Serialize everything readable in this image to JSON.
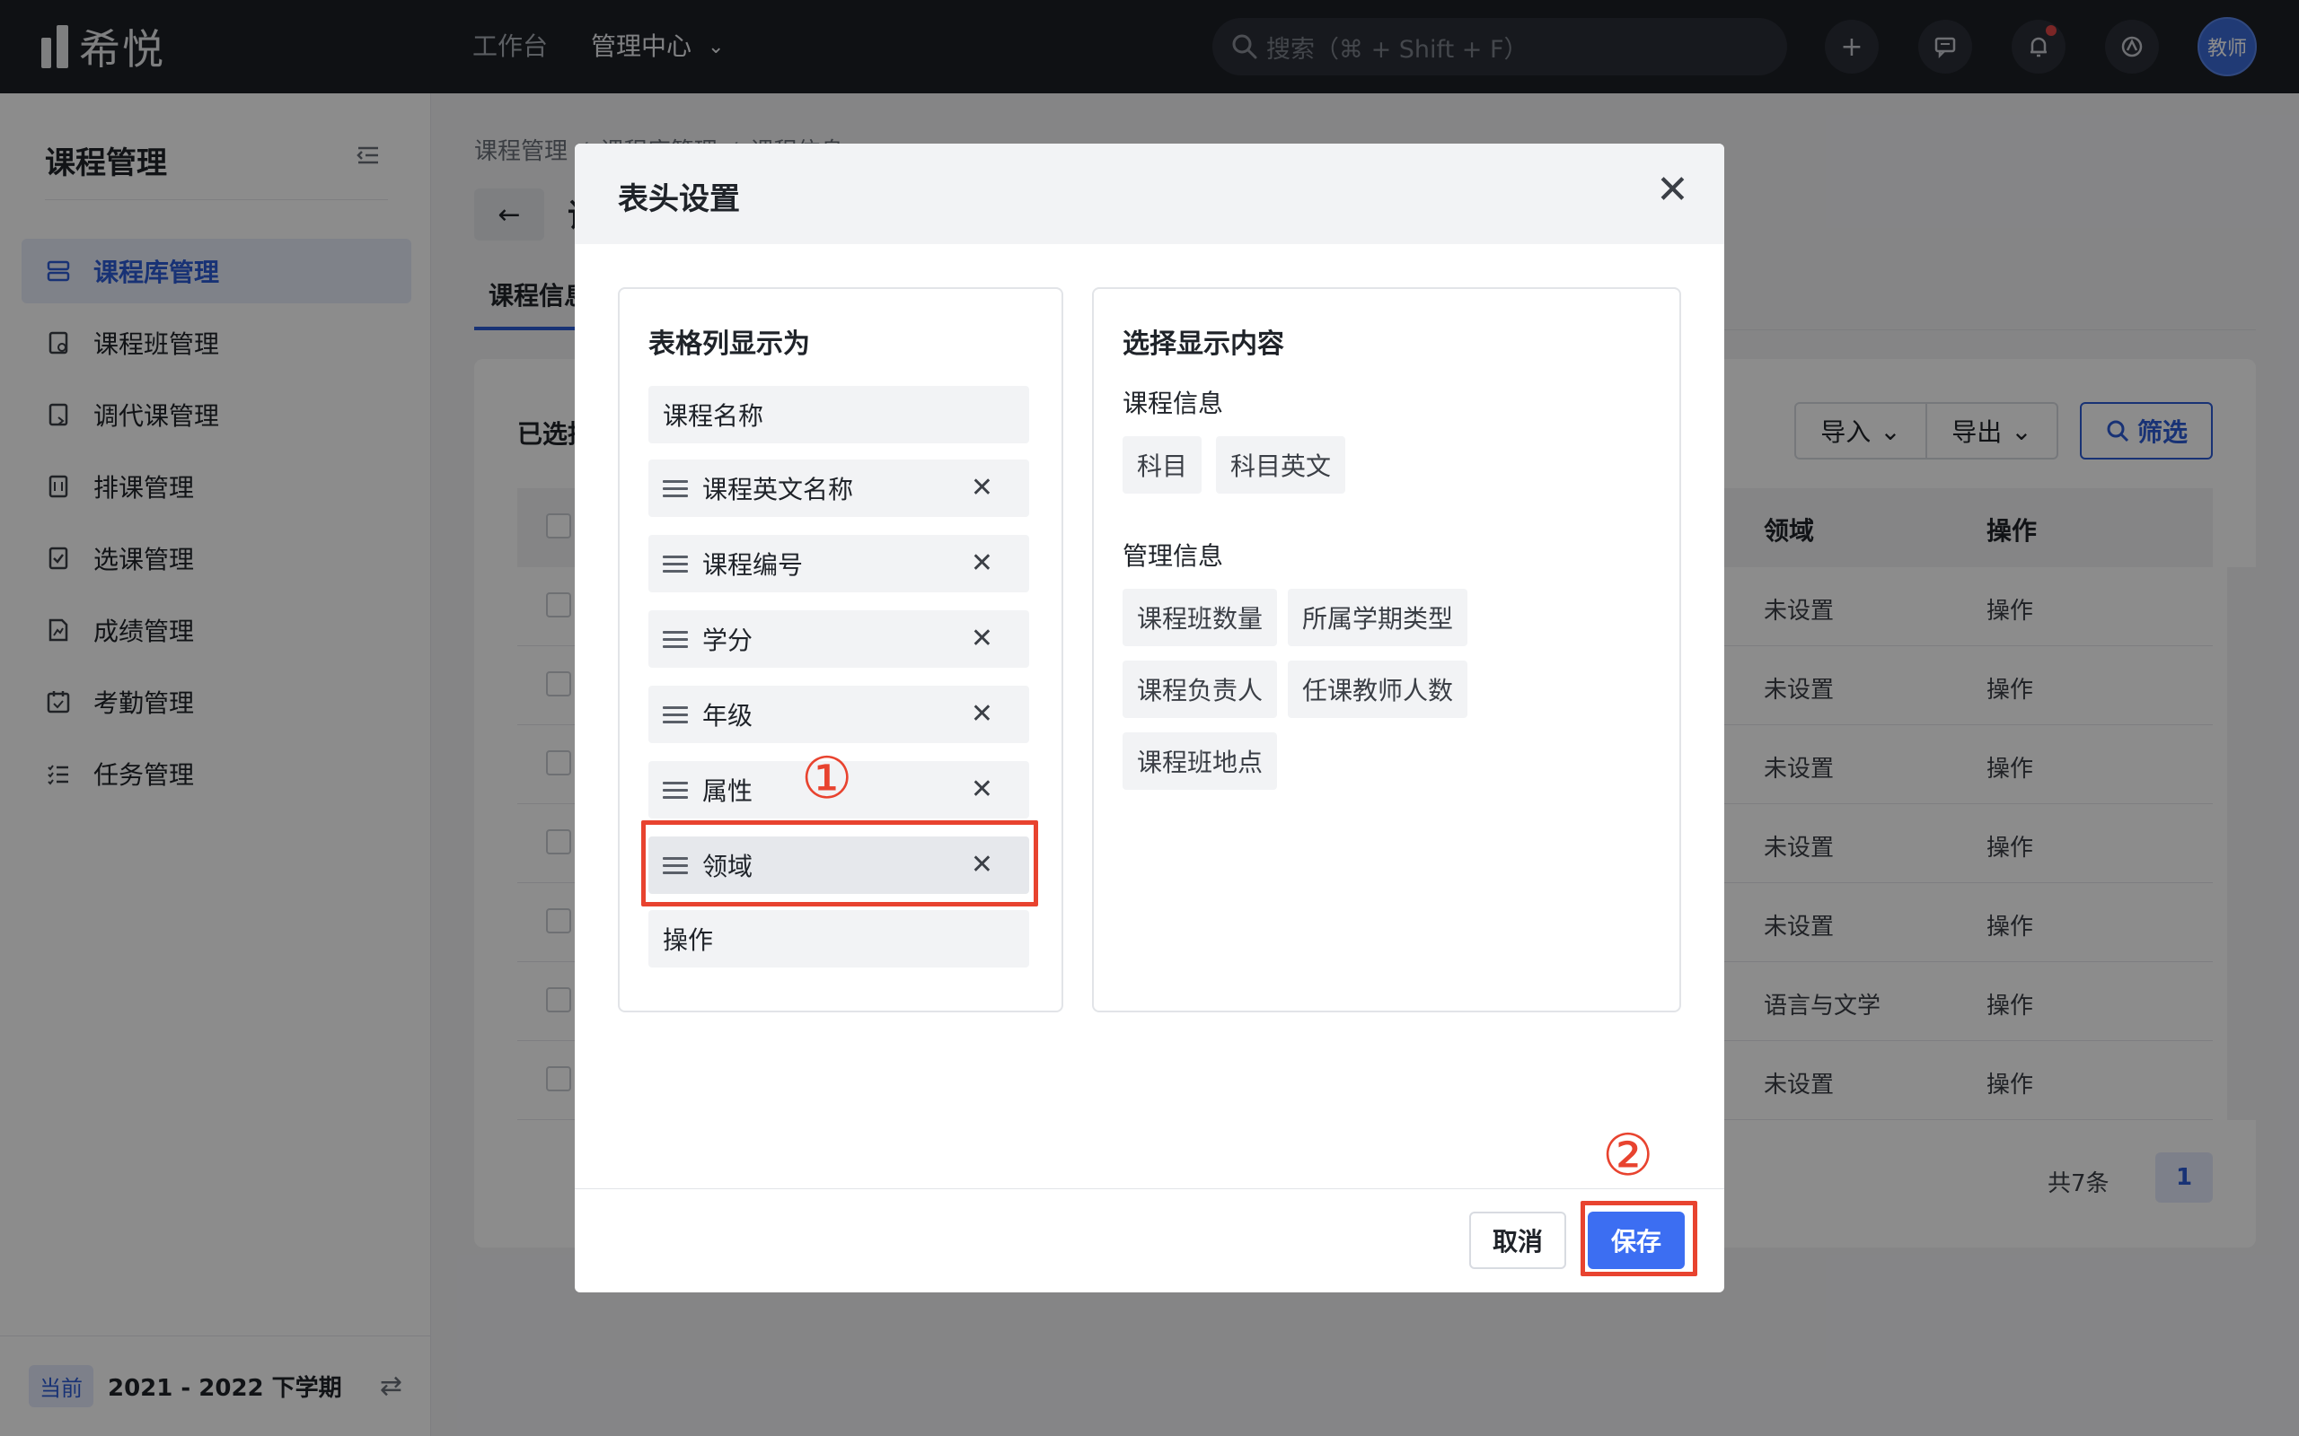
{
  "topbar": {
    "logo_text": "希悦",
    "nav": [
      {
        "label": "工作台"
      },
      {
        "label": "管理中心"
      }
    ],
    "search_placeholder": "搜索（⌘ + Shift + F）",
    "avatar_label": "教师",
    "colors": {
      "background": "#1c1f26",
      "notification_dot": "#e04545"
    }
  },
  "sidebar": {
    "title": "课程管理",
    "items": [
      {
        "label": "课程库管理",
        "icon": "database-icon",
        "active": true
      },
      {
        "label": "课程班管理",
        "icon": "class-icon"
      },
      {
        "label": "调代课管理",
        "icon": "substitute-icon"
      },
      {
        "label": "排课管理",
        "icon": "schedule-icon"
      },
      {
        "label": "选课管理",
        "icon": "checklist-icon"
      },
      {
        "label": "成绩管理",
        "icon": "grade-icon"
      },
      {
        "label": "考勤管理",
        "icon": "calendar-check-icon"
      },
      {
        "label": "任务管理",
        "icon": "task-list-icon"
      }
    ],
    "footer": {
      "badge": "当前",
      "term": "2021 - 2022 下学期"
    }
  },
  "main": {
    "breadcrumb": [
      "课程管理",
      "课程库管理",
      "课程信息"
    ],
    "title_fragment": "课",
    "tab": "课程信息",
    "selected_label": "已选择",
    "toolbar": {
      "import": "导入",
      "export": "导出",
      "filter": "筛选"
    },
    "table": {
      "headers": {
        "domain": "领域",
        "actions": "操作"
      },
      "rows": [
        {
          "domain": "未设置",
          "action": "操作"
        },
        {
          "domain": "未设置",
          "action": "操作"
        },
        {
          "domain": "未设置",
          "action": "操作"
        },
        {
          "domain": "未设置",
          "action": "操作"
        },
        {
          "domain": "未设置",
          "action": "操作"
        },
        {
          "domain": "语言与文学",
          "action": "操作"
        },
        {
          "domain": "未设置",
          "action": "操作"
        }
      ]
    },
    "pagination": {
      "total": "共7条",
      "current_page": "1"
    }
  },
  "modal": {
    "title": "表头设置",
    "left_panel": {
      "title": "表格列显示为",
      "fixed_first": "课程名称",
      "columns": [
        "课程英文名称",
        "课程编号",
        "学分",
        "年级",
        "属性",
        "领域"
      ],
      "fixed_last": "操作"
    },
    "right_panel": {
      "title": "选择显示内容",
      "groups": [
        {
          "label": "课程信息",
          "chips": [
            "科目",
            "科目英文"
          ]
        },
        {
          "label": "管理信息",
          "chips": [
            "课程班数量",
            "所属学期类型",
            "课程负责人",
            "任课教师人数",
            "课程班地点"
          ]
        }
      ]
    },
    "buttons": {
      "cancel": "取消",
      "save": "保存"
    },
    "colors": {
      "primary": "#3c6ef2"
    }
  },
  "annotations": {
    "step1": "①",
    "step2": "②",
    "color": "#e8432f"
  }
}
